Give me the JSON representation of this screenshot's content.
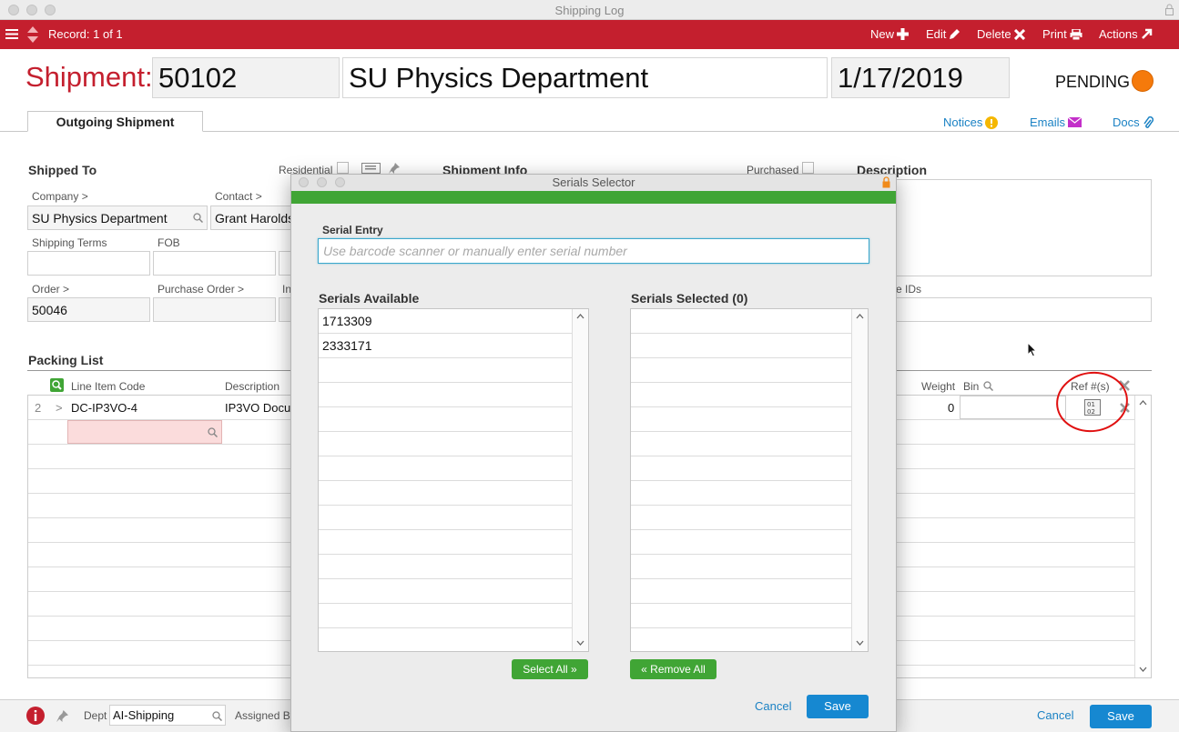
{
  "window": {
    "title": "Shipping Log"
  },
  "toolbar": {
    "record": "Record: 1 of 1",
    "new": "New",
    "edit": "Edit",
    "delete": "Delete",
    "print": "Print",
    "actions": "Actions"
  },
  "header": {
    "label": "Shipment:",
    "number": "50102",
    "company": "SU Physics Department",
    "date": "1/17/2019",
    "status": "PENDING",
    "status_color": "#f57a0b"
  },
  "tabs": {
    "outgoing": "Outgoing Shipment"
  },
  "header_links": {
    "notices": "Notices",
    "emails": "Emails",
    "docs": "Docs"
  },
  "shipped_to": {
    "title": "Shipped To",
    "residential": "Residential",
    "company_label": "Company >",
    "company_value": "SU Physics Department",
    "contact_label": "Contact >",
    "contact_value": "Grant Harolds",
    "terms_label": "Shipping Terms",
    "fob_label": "FOB",
    "order_label": "Order >",
    "order_value": "50046",
    "po_label": "Purchase Order >",
    "in_partial": "In"
  },
  "shipment_info": {
    "title": "Shipment Info",
    "purchased": "Purchased"
  },
  "description": {
    "title": "Description",
    "ids_partial": "e IDs"
  },
  "packing": {
    "title": "Packing List",
    "col_code": "Line Item Code",
    "col_desc": "Description",
    "col_weight": "Weight",
    "col_bin": "Bin",
    "col_ref": "Ref #(s)",
    "row": {
      "num": "2",
      "arrow": ">",
      "code": "DC-IP3VO-4",
      "desc": "IP3VO Docu",
      "weight": "0"
    }
  },
  "bottom": {
    "dept_label": "Dept",
    "dept_value": "AI-Shipping",
    "assigned_label": "Assigned By",
    "cancel": "Cancel",
    "save": "Save"
  },
  "modal": {
    "title": "Serials Selector",
    "entry_label": "Serial Entry",
    "entry_placeholder": "Use barcode scanner or manually enter serial number",
    "available_label": "Serials Available",
    "selected_label": "Serials Selected (0)",
    "available": [
      "1713309",
      "2333171"
    ],
    "select_all": "Select All",
    "remove_all": "Remove All",
    "cancel": "Cancel",
    "save": "Save",
    "accent": "#40a535"
  }
}
